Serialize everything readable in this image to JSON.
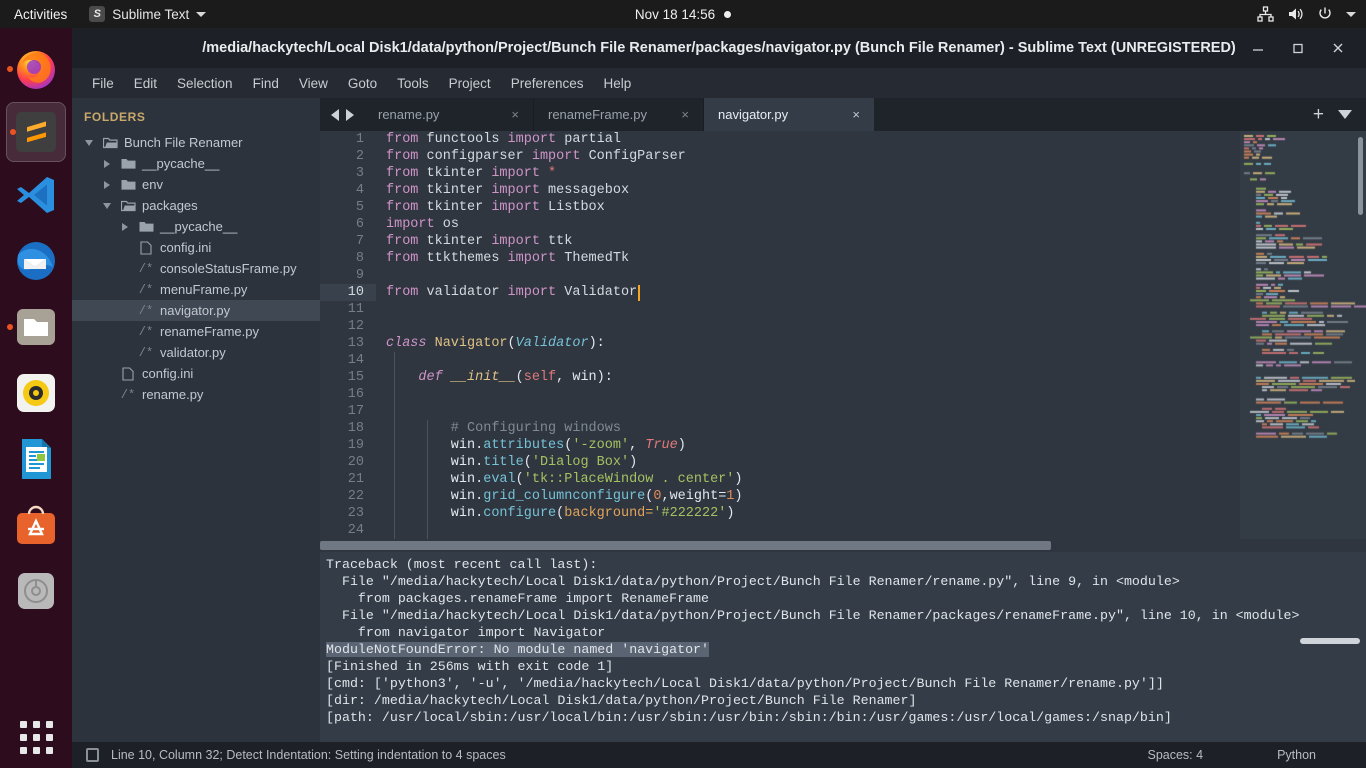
{
  "topbar": {
    "activities": "Activities",
    "app_name": "Sublime Text",
    "app_icon": "sublime-text-icon",
    "clock": "Nov 18  14:56",
    "recording_dot": "recording-indicator",
    "tray_icons": [
      "network-icon",
      "volume-icon",
      "power-icon",
      "chevron-down-icon"
    ]
  },
  "dock": {
    "items": [
      {
        "name": "firefox",
        "running": true
      },
      {
        "name": "sublime-text",
        "running": true,
        "active": true
      },
      {
        "name": "visual-studio-code",
        "running": false
      },
      {
        "name": "thunderbird",
        "running": false
      },
      {
        "name": "files",
        "running": true
      },
      {
        "name": "rhythmbox",
        "running": false
      },
      {
        "name": "libreoffice-writer",
        "running": false
      },
      {
        "name": "ubuntu-software",
        "running": false
      },
      {
        "name": "disk-usage",
        "running": false
      }
    ],
    "show_apps_label": "Show Applications"
  },
  "window": {
    "title": "/media/hackytech/Local Disk1/data/python/Project/Bunch File Renamer/packages/navigator.py (Bunch File Renamer) - Sublime Text (UNREGISTERED)",
    "minimize": "minimize-button",
    "maximize": "maximize-button",
    "close": "close-button"
  },
  "menubar": {
    "items": [
      "File",
      "Edit",
      "Selection",
      "Find",
      "View",
      "Goto",
      "Tools",
      "Project",
      "Preferences",
      "Help"
    ]
  },
  "sidebar": {
    "header": "FOLDERS",
    "tree": [
      {
        "label": "Bunch File Renamer",
        "indent": 0,
        "icon": "folder-open-icon",
        "twisty": "down",
        "selected": false
      },
      {
        "label": "__pycache__",
        "indent": 1,
        "icon": "folder-icon",
        "twisty": "right",
        "selected": false
      },
      {
        "label": "env",
        "indent": 1,
        "icon": "folder-icon",
        "twisty": "right",
        "selected": false
      },
      {
        "label": "packages",
        "indent": 1,
        "icon": "folder-open-icon",
        "twisty": "down",
        "selected": false
      },
      {
        "label": "__pycache__",
        "indent": 2,
        "icon": "folder-icon",
        "twisty": "right",
        "selected": false
      },
      {
        "label": "config.ini",
        "indent": 2,
        "icon": "file-icon",
        "twisty": "none",
        "selected": false
      },
      {
        "label": "consoleStatusFrame.py",
        "indent": 2,
        "icon": "python-file-icon",
        "twisty": "none",
        "selected": false
      },
      {
        "label": "menuFrame.py",
        "indent": 2,
        "icon": "python-file-icon",
        "twisty": "none",
        "selected": false
      },
      {
        "label": "navigator.py",
        "indent": 2,
        "icon": "python-file-icon",
        "twisty": "none",
        "selected": true
      },
      {
        "label": "renameFrame.py",
        "indent": 2,
        "icon": "python-file-icon",
        "twisty": "none",
        "selected": false
      },
      {
        "label": "validator.py",
        "indent": 2,
        "icon": "python-file-icon",
        "twisty": "none",
        "selected": false
      },
      {
        "label": "config.ini",
        "indent": 1,
        "icon": "file-icon",
        "twisty": "none",
        "selected": false
      },
      {
        "label": "rename.py",
        "indent": 1,
        "icon": "python-file-icon",
        "twisty": "none",
        "selected": false
      }
    ]
  },
  "tabs": {
    "nav_prev": "previous-tab-arrow",
    "nav_next": "next-tab-arrow",
    "close_glyph": "×",
    "items": [
      {
        "label": "rename.py",
        "active": false
      },
      {
        "label": "renameFrame.py",
        "active": false
      },
      {
        "label": "navigator.py",
        "active": true
      }
    ],
    "new_tab": "+",
    "tab_menu": "tab-dropdown-icon"
  },
  "editor": {
    "first_line": 1,
    "cursor_line": 10,
    "lines": [
      {
        "n": 1,
        "tokens": [
          {
            "t": "from ",
            "c": "kw"
          },
          {
            "t": "functools ",
            "c": "mod"
          },
          {
            "t": "import ",
            "c": "kw"
          },
          {
            "t": "partial",
            "c": "mod"
          }
        ]
      },
      {
        "n": 2,
        "tokens": [
          {
            "t": "from ",
            "c": "kw"
          },
          {
            "t": "configparser ",
            "c": "mod"
          },
          {
            "t": "import ",
            "c": "kw"
          },
          {
            "t": "ConfigParser",
            "c": "mod"
          }
        ]
      },
      {
        "n": 3,
        "tokens": [
          {
            "t": "from ",
            "c": "kw"
          },
          {
            "t": "tkinter ",
            "c": "mod"
          },
          {
            "t": "import ",
            "c": "kw"
          },
          {
            "t": "*",
            "c": "star"
          }
        ]
      },
      {
        "n": 4,
        "tokens": [
          {
            "t": "from ",
            "c": "kw"
          },
          {
            "t": "tkinter ",
            "c": "mod"
          },
          {
            "t": "import ",
            "c": "kw"
          },
          {
            "t": "messagebox",
            "c": "mod"
          }
        ]
      },
      {
        "n": 5,
        "tokens": [
          {
            "t": "from ",
            "c": "kw"
          },
          {
            "t": "tkinter ",
            "c": "mod"
          },
          {
            "t": "import ",
            "c": "kw"
          },
          {
            "t": "Listbox",
            "c": "mod"
          }
        ]
      },
      {
        "n": 6,
        "tokens": [
          {
            "t": "import ",
            "c": "kw"
          },
          {
            "t": "os",
            "c": "mod"
          }
        ]
      },
      {
        "n": 7,
        "tokens": [
          {
            "t": "from ",
            "c": "kw"
          },
          {
            "t": "tkinter ",
            "c": "mod"
          },
          {
            "t": "import ",
            "c": "kw"
          },
          {
            "t": "ttk",
            "c": "mod"
          }
        ]
      },
      {
        "n": 8,
        "tokens": [
          {
            "t": "from ",
            "c": "kw"
          },
          {
            "t": "ttkthemes ",
            "c": "mod"
          },
          {
            "t": "import ",
            "c": "kw"
          },
          {
            "t": "ThemedTk",
            "c": "mod"
          }
        ]
      },
      {
        "n": 9,
        "tokens": []
      },
      {
        "n": 10,
        "tokens": [
          {
            "t": "from ",
            "c": "kw"
          },
          {
            "t": "validator ",
            "c": "mod"
          },
          {
            "t": "import ",
            "c": "kw"
          },
          {
            "t": "Validator",
            "c": "mod"
          }
        ]
      },
      {
        "n": 11,
        "tokens": []
      },
      {
        "n": 12,
        "tokens": []
      },
      {
        "n": 13,
        "tokens": [
          {
            "t": "class ",
            "c": "kw ital"
          },
          {
            "t": "Navigator",
            "c": "cls"
          },
          {
            "t": "(",
            "c": "op"
          },
          {
            "t": "Validator",
            "c": "fn ital"
          },
          {
            "t": "):",
            "c": "op"
          }
        ]
      },
      {
        "n": 14,
        "tokens": []
      },
      {
        "n": 15,
        "tokens": [
          {
            "t": "    ",
            "c": "op"
          },
          {
            "t": "def ",
            "c": "kw ital"
          },
          {
            "t": "__init__",
            "c": "cls ital"
          },
          {
            "t": "(",
            "c": "op"
          },
          {
            "t": "self",
            "c": "cnst"
          },
          {
            "t": ", win):",
            "c": "op"
          }
        ]
      },
      {
        "n": 16,
        "tokens": []
      },
      {
        "n": 17,
        "tokens": []
      },
      {
        "n": 18,
        "tokens": [
          {
            "t": "        # Configuring windows",
            "c": "cmt"
          }
        ]
      },
      {
        "n": 19,
        "tokens": [
          {
            "t": "        win",
            "c": "op"
          },
          {
            "t": ".",
            "c": "op"
          },
          {
            "t": "attributes",
            "c": "fn"
          },
          {
            "t": "(",
            "c": "op"
          },
          {
            "t": "'-zoom'",
            "c": "str"
          },
          {
            "t": ", ",
            "c": "op"
          },
          {
            "t": "True",
            "c": "cnst ital"
          },
          {
            "t": ")",
            "c": "op"
          }
        ]
      },
      {
        "n": 20,
        "tokens": [
          {
            "t": "        win",
            "c": "op"
          },
          {
            "t": ".",
            "c": "op"
          },
          {
            "t": "title",
            "c": "fn"
          },
          {
            "t": "(",
            "c": "op"
          },
          {
            "t": "'Dialog Box'",
            "c": "str"
          },
          {
            "t": ")",
            "c": "op"
          }
        ]
      },
      {
        "n": 21,
        "tokens": [
          {
            "t": "        win",
            "c": "op"
          },
          {
            "t": ".",
            "c": "op"
          },
          {
            "t": "eval",
            "c": "fn"
          },
          {
            "t": "(",
            "c": "op"
          },
          {
            "t": "'tk::PlaceWindow . center'",
            "c": "str"
          },
          {
            "t": ")",
            "c": "op"
          }
        ]
      },
      {
        "n": 22,
        "tokens": [
          {
            "t": "        win",
            "c": "op"
          },
          {
            "t": ".",
            "c": "op"
          },
          {
            "t": "grid_columnconfigure",
            "c": "fn"
          },
          {
            "t": "(",
            "c": "op"
          },
          {
            "t": "0",
            "c": "num"
          },
          {
            "t": ",weight=",
            "c": "op"
          },
          {
            "t": "1",
            "c": "num"
          },
          {
            "t": ")",
            "c": "op"
          }
        ]
      },
      {
        "n": 23,
        "tokens": [
          {
            "t": "        win",
            "c": "op"
          },
          {
            "t": ".",
            "c": "op"
          },
          {
            "t": "configure",
            "c": "fn"
          },
          {
            "t": "(",
            "c": "op"
          },
          {
            "t": "background=",
            "c": "kwarg"
          },
          {
            "t": "'#222222'",
            "c": "str"
          },
          {
            "t": ")",
            "c": "op"
          }
        ]
      },
      {
        "n": 24,
        "tokens": []
      }
    ]
  },
  "console": {
    "lines": [
      {
        "text": "Traceback (most recent call last):",
        "highlight": false
      },
      {
        "text": "  File \"/media/hackytech/Local Disk1/data/python/Project/Bunch File Renamer/rename.py\", line 9, in <module>",
        "highlight": false
      },
      {
        "text": "    from packages.renameFrame import RenameFrame",
        "highlight": false
      },
      {
        "text": "  File \"/media/hackytech/Local Disk1/data/python/Project/Bunch File Renamer/packages/renameFrame.py\", line 10, in <module>",
        "highlight": false
      },
      {
        "text": "    from navigator import Navigator",
        "highlight": false
      },
      {
        "text": "ModuleNotFoundError: No module named 'navigator'",
        "highlight": true
      },
      {
        "text": "[Finished in 256ms with exit code 1]",
        "highlight": false
      },
      {
        "text": "[cmd: ['python3', '-u', '/media/hackytech/Local Disk1/data/python/Project/Bunch File Renamer/rename.py']]",
        "highlight": false
      },
      {
        "text": "[dir: /media/hackytech/Local Disk1/data/python/Project/Bunch File Renamer]",
        "highlight": false
      },
      {
        "text": "[path: /usr/local/sbin:/usr/local/bin:/usr/sbin:/usr/bin:/sbin:/bin:/usr/games:/usr/local/games:/snap/bin]",
        "highlight": false
      }
    ]
  },
  "statusbar": {
    "icon": "indentation-icon",
    "message": "Line 10, Column 32; Detect Indentation: Setting indentation to 4 spaces",
    "spaces": "Spaces: 4",
    "syntax": "Python"
  },
  "colors": {
    "accent_orange": "#e95420",
    "editor_bg": "#2f3640",
    "sidebar_bg": "#2d333d",
    "console_bg": "#343c47",
    "titlebar_bg": "#1d2026",
    "caret": "#f6a623",
    "error_highlight": "#5a6472",
    "folders_header": "#c9a96a"
  }
}
